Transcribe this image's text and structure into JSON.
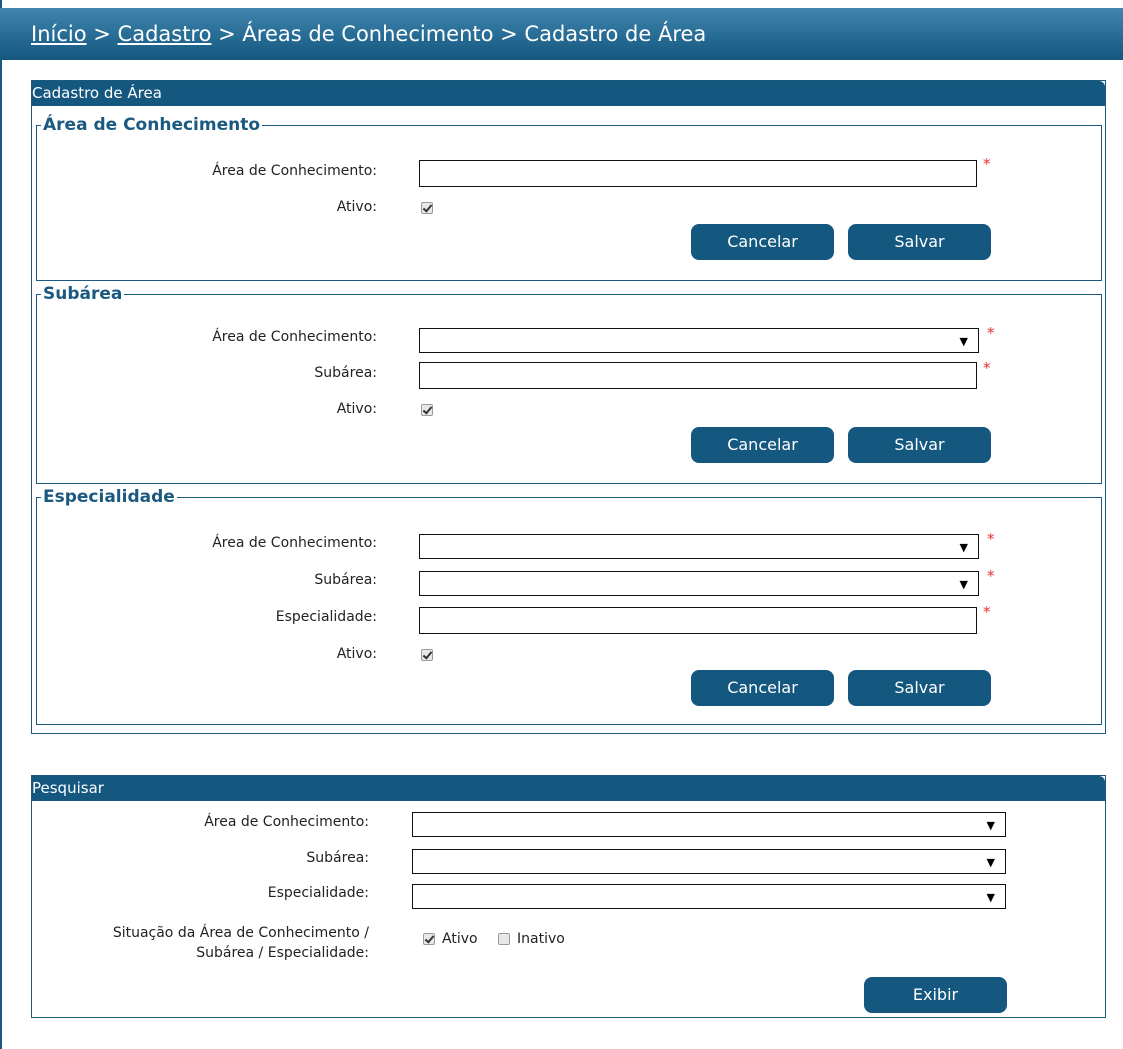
{
  "breadcrumb": {
    "home": "Início",
    "sep1": " > ",
    "cadastro": "Cadastro",
    "rest": " > Áreas de Conhecimento > Cadastro de Área"
  },
  "cadastro_panel": {
    "title": "Cadastro de Área",
    "area_section": {
      "legend": "Área de Conhecimento",
      "area_label": "Área de Conhecimento:",
      "area_value": "",
      "ativo_label": "Ativo:",
      "ativo_checked": true,
      "cancel": "Cancelar",
      "save": "Salvar"
    },
    "subarea_section": {
      "legend": "Subárea",
      "area_label": "Área de Conhecimento:",
      "area_selected": "",
      "subarea_label": "Subárea:",
      "subarea_value": "",
      "ativo_label": "Ativo:",
      "ativo_checked": true,
      "cancel": "Cancelar",
      "save": "Salvar"
    },
    "especialidade_section": {
      "legend": "Especialidade",
      "area_label": "Área de Conhecimento:",
      "area_selected": "",
      "subarea_label": "Subárea:",
      "subarea_selected": "",
      "especialidade_label": "Especialidade:",
      "especialidade_value": "",
      "ativo_label": "Ativo:",
      "ativo_checked": true,
      "cancel": "Cancelar",
      "save": "Salvar"
    },
    "required_mark": "*"
  },
  "pesquisar_panel": {
    "title": "Pesquisar",
    "area_label": "Área de Conhecimento:",
    "subarea_label": "Subárea:",
    "especialidade_label": "Especialidade:",
    "situacao_label_line1": "Situação da Área de Conhecimento /",
    "situacao_label_line2": "Subárea / Especialidade:",
    "ativo_option": "Ativo",
    "ativo_checked": true,
    "inativo_option": "Inativo",
    "inativo_checked": false,
    "show_button": "Exibir"
  },
  "colors": {
    "primary": "#14577f",
    "required": "#e53030"
  },
  "icons": {
    "dropdown": "▼"
  }
}
